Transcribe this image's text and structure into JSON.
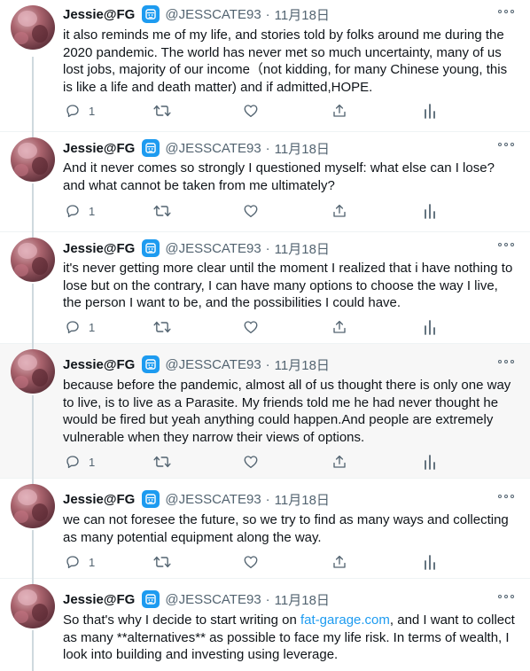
{
  "author": {
    "name": "Jessie@FG",
    "handle": "@JESSCATE93",
    "date": "11月18日",
    "separator": "·"
  },
  "tweets": [
    {
      "text": "it also reminds me of my life, and stories told by folks around me during the 2020 pandemic. The world has never met so much uncertainty, many of us lost jobs, majority of our income（not kidding, for many Chinese young, this is like a life and death matter) and if admitted,HOPE.",
      "reply_count": "1"
    },
    {
      "text": "And it never comes so strongly I questioned myself: what else can I lose? and what cannot be taken from me ultimately?",
      "reply_count": "1"
    },
    {
      "text": "it's never getting more clear until the moment I realized that i have nothing to lose but on the contrary, I can have many options to choose the way I live, the person I want to be, and the possibilities I could have.",
      "reply_count": "1"
    },
    {
      "text": "because before the pandemic, almost all of us thought there is only one way to live, is to live as a Parasite. My friends told me he had never thought he would be fired but yeah anything could happen.And people are extremely vulnerable when they narrow their views of options.",
      "reply_count": "1"
    },
    {
      "text": "we can not foresee the future, so we try to find as many ways and collecting as many potential equipment along the way.",
      "reply_count": "1"
    },
    {
      "text_before": "So that's why I decide to start writing on ",
      "link": "fat-garage.com",
      "text_after": ", and I want to collect as many **alternatives** as possible to face my life risk. In terms of wealth, I look into building and investing using leverage."
    }
  ],
  "icons": {
    "reply": "reply-icon",
    "retweet": "retweet-icon",
    "like": "like-icon",
    "share": "share-icon",
    "analytics": "analytics-icon",
    "more": "more-icon",
    "badge": "emoji-badge-icon"
  },
  "colors": {
    "text": "#0f1419",
    "secondary": "#536471",
    "link": "#1d9bf0",
    "highlight_bg": "#f7f7f7",
    "thread_line": "#cfd9de"
  }
}
